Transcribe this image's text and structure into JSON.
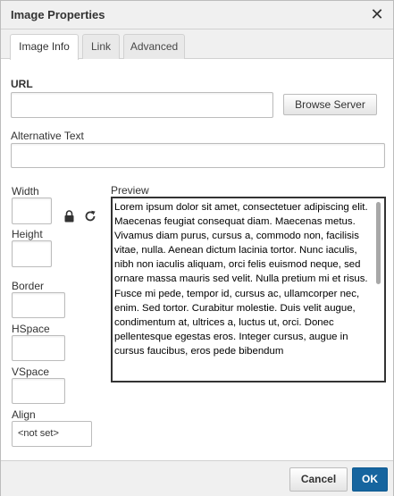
{
  "dialog": {
    "title": "Image Properties"
  },
  "tabs": [
    {
      "label": "Image Info",
      "active": true
    },
    {
      "label": "Link"
    },
    {
      "label": "Advanced"
    }
  ],
  "url": {
    "label": "URL",
    "value": ""
  },
  "browse_button": "Browse Server",
  "alt_text": {
    "label": "Alternative Text",
    "value": ""
  },
  "width": {
    "label": "Width",
    "value": ""
  },
  "height": {
    "label": "Height",
    "value": ""
  },
  "border": {
    "label": "Border",
    "value": ""
  },
  "hspace": {
    "label": "HSpace",
    "value": ""
  },
  "vspace": {
    "label": "VSpace",
    "value": ""
  },
  "align": {
    "label": "Align",
    "selected": "<not set>"
  },
  "preview": {
    "label": "Preview",
    "text": "Lorem ipsum dolor sit amet, consectetuer adipiscing elit. Maecenas feugiat consequat diam. Maecenas metus. Vivamus diam purus, cursus a, commodo non, facilisis vitae, nulla. Aenean dictum lacinia tortor. Nunc iaculis, nibh non iaculis aliquam, orci felis euismod neque, sed ornare massa mauris sed velit. Nulla pretium mi et risus. Fusce mi pede, tempor id, cursus ac, ullamcorper nec, enim. Sed tortor. Curabitur molestie. Duis velit augue, condimentum at, ultrices a, luctus ut, orci. Donec pellentesque egestas eros. Integer cursus, augue in cursus faucibus, eros pede bibendum"
  },
  "footer": {
    "cancel": "Cancel",
    "ok": "OK"
  },
  "colors": {
    "ok_button": "#16659f",
    "border": "#bcbcbc",
    "bar": "#f0f0f0"
  },
  "icons": {
    "close": "close-icon",
    "lock": "lock-icon",
    "reset": "reset-size-icon"
  }
}
